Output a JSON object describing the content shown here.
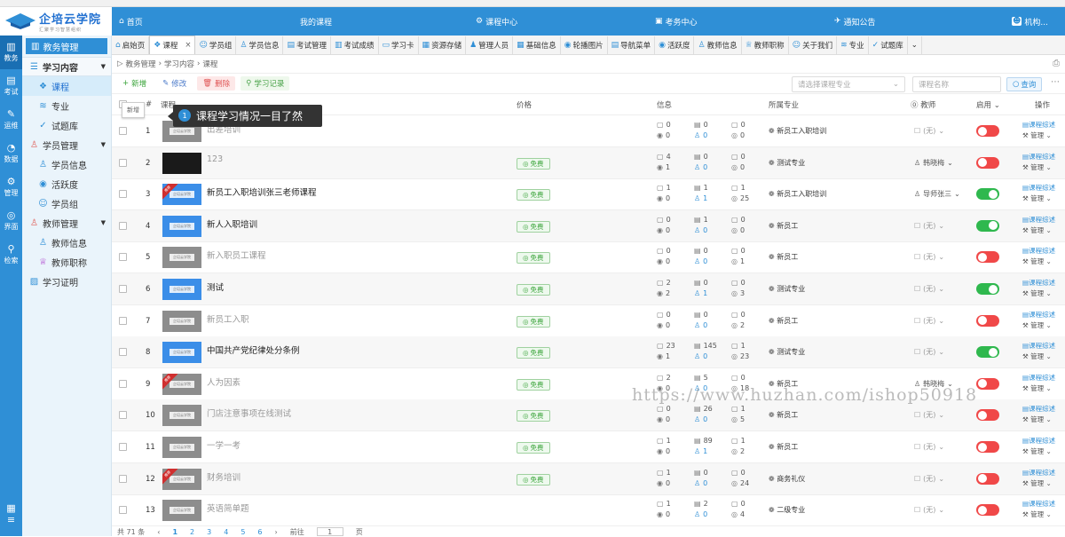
{
  "brand": {
    "name": "企培云学院",
    "slogan": "汇聚学习智慧组织"
  },
  "topnav": {
    "home": "首页",
    "my_courses": "我的课程",
    "course_center": "课程中心",
    "exam_center": "考务中心",
    "notice": "通知公告",
    "user": "机构..."
  },
  "leftbar": [
    "教务",
    "考试",
    "运维",
    "数据",
    "管理",
    "界面",
    "检索"
  ],
  "sidebar": {
    "header": "教务管理",
    "sections": [
      {
        "label": "学习内容",
        "items": [
          "课程",
          "专业",
          "试题库"
        ]
      },
      {
        "label": "学员管理",
        "items": [
          "学员信息",
          "活跃度",
          "学员组"
        ]
      },
      {
        "label": "教师管理",
        "items": [
          "教师信息",
          "教师职称"
        ]
      }
    ],
    "extra": "学习证明"
  },
  "tabs": [
    "启始页",
    "课程",
    "学员组",
    "学员信息",
    "考试管理",
    "考试成绩",
    "学习卡",
    "资源存储",
    "管理人员",
    "基础信息",
    "轮播图片",
    "导航菜单",
    "活跃度",
    "教师信息",
    "教师职称",
    "关于我们",
    "专业",
    "试题库"
  ],
  "breadcrumb": [
    "教务管理",
    "学习内容",
    "课程"
  ],
  "toolbar": {
    "add": "新增",
    "edit": "修改",
    "delete": "删除",
    "record": "学习记录",
    "major_placeholder": "请选择课程专业",
    "name_placeholder": "课程名称",
    "search": "查询"
  },
  "table": {
    "headers": {
      "course": "课程",
      "price": "价格",
      "info": "信息",
      "major": "所属专业",
      "teacher": "教师",
      "enabled": "启用",
      "ops": "操作",
      "num": "#"
    },
    "rows": [
      {
        "idx": "1",
        "name": "出差培训",
        "thumb": "gray",
        "rec": false,
        "free": "",
        "i1": "0",
        "i2": "0",
        "i3": "0",
        "i4": "0",
        "i5": "0",
        "i6": "0",
        "major": "新员工入职培训",
        "teacher": "(无)",
        "on": false
      },
      {
        "idx": "2",
        "name": "123",
        "thumb": "dark",
        "rec": false,
        "free": "免费",
        "i1": "4",
        "i2": "0",
        "i3": "0",
        "i4": "1",
        "i5": "0",
        "i6": "0",
        "major": "测试专业",
        "teacher": "韩晓梅",
        "on": false
      },
      {
        "idx": "3",
        "name": "新员工入职培训张三老师课程",
        "thumb": "blue",
        "rec": true,
        "free": "免费",
        "i1": "1",
        "i2": "1",
        "i3": "1",
        "i4": "0",
        "i5": "1",
        "i6": "25",
        "major": "新员工入职培训",
        "teacher": "导师张三",
        "on": true
      },
      {
        "idx": "4",
        "name": "新人入职培训",
        "thumb": "blue",
        "rec": false,
        "free": "免费",
        "i1": "0",
        "i2": "1",
        "i3": "0",
        "i4": "0",
        "i5": "0",
        "i6": "0",
        "major": "新员工",
        "teacher": "(无)",
        "on": true
      },
      {
        "idx": "5",
        "name": "新入职员工课程",
        "thumb": "gray",
        "rec": false,
        "free": "免费",
        "i1": "0",
        "i2": "0",
        "i3": "0",
        "i4": "0",
        "i5": "0",
        "i6": "1",
        "major": "新员工",
        "teacher": "(无)",
        "on": false
      },
      {
        "idx": "6",
        "name": "测试",
        "thumb": "blue",
        "rec": false,
        "free": "免费",
        "i1": "2",
        "i2": "0",
        "i3": "0",
        "i4": "2",
        "i5": "1",
        "i6": "3",
        "major": "测试专业",
        "teacher": "(无)",
        "on": true
      },
      {
        "idx": "7",
        "name": "新员工入职",
        "thumb": "gray",
        "rec": false,
        "free": "免费",
        "i1": "0",
        "i2": "0",
        "i3": "0",
        "i4": "0",
        "i5": "0",
        "i6": "2",
        "major": "新员工",
        "teacher": "(无)",
        "on": false
      },
      {
        "idx": "8",
        "name": "中国共产党纪律处分条例",
        "thumb": "blue",
        "rec": false,
        "free": "免费",
        "i1": "23",
        "i2": "145",
        "i3": "1",
        "i4": "1",
        "i5": "0",
        "i6": "23",
        "major": "测试专业",
        "teacher": "(无)",
        "on": true
      },
      {
        "idx": "9",
        "name": "人为因素",
        "thumb": "gray",
        "rec": true,
        "free": "免费",
        "i1": "2",
        "i2": "5",
        "i3": "0",
        "i4": "0",
        "i5": "0",
        "i6": "18",
        "major": "新员工",
        "teacher": "韩晓梅",
        "on": false
      },
      {
        "idx": "10",
        "name": "门店注意事项在线测试",
        "thumb": "gray",
        "rec": false,
        "free": "免费",
        "i1": "0",
        "i2": "26",
        "i3": "1",
        "i4": "0",
        "i5": "0",
        "i6": "5",
        "major": "新员工",
        "teacher": "(无)",
        "on": false
      },
      {
        "idx": "11",
        "name": "一学一考",
        "thumb": "gray",
        "rec": false,
        "free": "免费",
        "i1": "1",
        "i2": "89",
        "i3": "1",
        "i4": "0",
        "i5": "1",
        "i6": "2",
        "major": "新员工",
        "teacher": "(无)",
        "on": false
      },
      {
        "idx": "12",
        "name": "财务培训",
        "thumb": "gray",
        "rec": true,
        "free": "免费",
        "i1": "1",
        "i2": "0",
        "i3": "0",
        "i4": "0",
        "i5": "0",
        "i6": "24",
        "major": "商务礼仪",
        "teacher": "(无)",
        "on": false
      },
      {
        "idx": "13",
        "name": "英语简单题",
        "thumb": "gray",
        "rec": false,
        "free": "",
        "i1": "1",
        "i2": "2",
        "i3": "0",
        "i4": "0",
        "i5": "0",
        "i6": "4",
        "major": "二级专业",
        "teacher": "(无)",
        "on": false
      }
    ],
    "op_detail": "课程综述",
    "op_manage": "管理"
  },
  "ribbon_text": "推荐",
  "thumb_text": "企培云学院",
  "tooltip": {
    "num": "1",
    "text": "课程学习情况一目了然"
  },
  "newtip": "新增",
  "watermark": "https://www.huzhan.com/ishop50918",
  "pager": {
    "total": "共 71 条",
    "pages": [
      "1",
      "2",
      "3",
      "4",
      "5",
      "6"
    ],
    "goto": "前往",
    "page_val": "1",
    "page_unit": "页"
  }
}
